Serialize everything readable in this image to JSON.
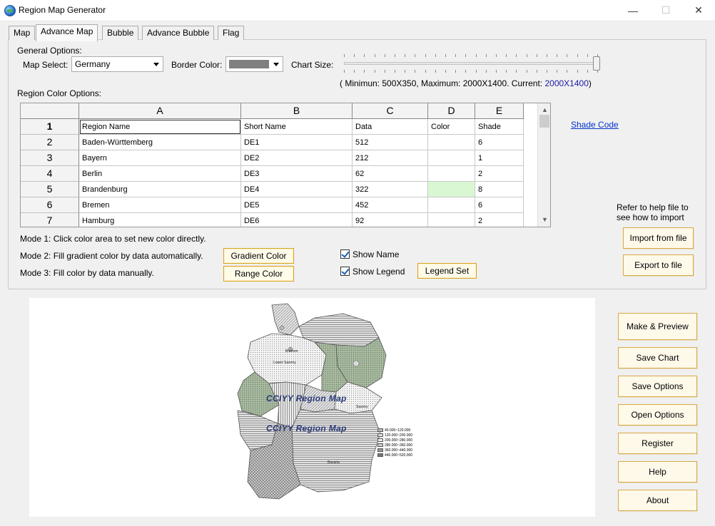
{
  "window": {
    "title": "Region Map Generator",
    "min_glyph": "—",
    "max_glyph": "☐",
    "close_glyph": "✕"
  },
  "tabs": [
    {
      "label": "Map"
    },
    {
      "label": "Advance Map",
      "active": true
    },
    {
      "label": "Bubble"
    },
    {
      "label": "Advance Bubble"
    },
    {
      "label": "Flag"
    }
  ],
  "general": {
    "heading": "General Options:",
    "map_select_label": "Map Select:",
    "map_select_value": "Germany",
    "border_color_label": "Border Color:",
    "border_color_swatch": "#808080",
    "chart_size_label": "Chart Size:",
    "chart_size_prefix": "( Minimun: 500X350, Maximum: 2000X1400.  Current: ",
    "chart_size_current": "2000X1400",
    "chart_size_suffix": ")",
    "slider_fraction": 1.0
  },
  "region_color": {
    "heading": "Region Color Options:",
    "columns": [
      "A",
      "B",
      "C",
      "D",
      "E"
    ],
    "row_numbers": [
      "1",
      "2",
      "3",
      "4",
      "5",
      "6",
      "7"
    ],
    "header_row": [
      "Region Name",
      "Short Name",
      "Data",
      "Color",
      "Shade"
    ],
    "rows": [
      [
        "Baden-Württemberg",
        "DE1",
        "512",
        "",
        "6"
      ],
      [
        "Bayern",
        "DE2",
        "212",
        "",
        "1"
      ],
      [
        "Berlin",
        "DE3",
        "62",
        "",
        "2"
      ],
      [
        "Brandenburg",
        "DE4",
        "322",
        "",
        "8"
      ],
      [
        "Bremen",
        "DE5",
        "452",
        "",
        "6"
      ],
      [
        "Hamburg",
        "DE6",
        "92",
        "",
        "2"
      ]
    ],
    "highlight_color": "#d9f7d3",
    "shade_code_link": "Shade Code"
  },
  "modes": {
    "mode1": "Mode 1: Click color area to set new color directly.",
    "mode2": "Mode 2: Fill gradient color by data automatically.",
    "mode3": "Mode 3: Fill color by data manually.",
    "gradient_button": "Gradient Color",
    "range_button": "Range Color",
    "show_name": "Show Name",
    "show_legend": "Show Legend",
    "legend_set_button": "Legend Set"
  },
  "import": {
    "help_line1": "Refer to help file to",
    "help_line2": "see how to import",
    "import_button": "Import from file",
    "export_button": "Export to file"
  },
  "actions": {
    "make_preview": "Make & Preview",
    "save_chart": "Save Chart",
    "save_options": "Save Options",
    "open_options": "Open Options",
    "register": "Register",
    "help": "Help",
    "about": "About"
  },
  "preview": {
    "watermark": "CCIYY Region Map",
    "region_labels": {
      "bremen": "Bremen",
      "lower_saxony": "Lower Saxony",
      "saxony": "Saxony",
      "bavaria": "Bavaria"
    },
    "legend": [
      "40.000~120.000",
      "120.000~200.000",
      "200.000~280.000",
      "280.000~360.000",
      "360.000~440.000",
      "440.000~520.000"
    ]
  }
}
